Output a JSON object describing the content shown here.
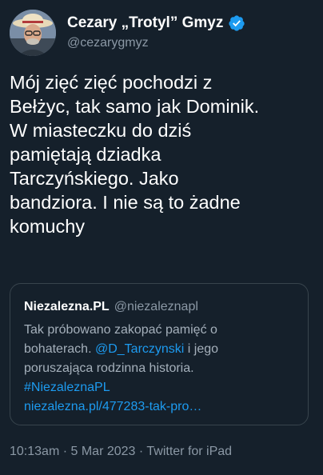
{
  "author": {
    "display_name": "Cezary „Trotyl” Gmyz",
    "handle": "@cezarygmyz",
    "verified": true
  },
  "tweet": {
    "text": "Mój zięć zięć pochodzi z\nBełżyc, tak samo jak Dominik.\nW miasteczku do dziś\npamiętają dziadka\nTarczyńskiego. Jako\nbandziora. I nie są to żadne\nkomuchy"
  },
  "quoted_tweet": {
    "author_name": "Niezalezna.PL",
    "author_handle": "@niezaleznapl",
    "line1": "Tak próbowano zakopać pamięć o",
    "line2_before": "bohaterach.",
    "line2_mention": "@D_Tarczynski",
    "line2_after": "i jego",
    "line3": "poruszająca rodzinna historia.",
    "hashtag": "#NiezaleznaPL",
    "url": "niezalezna.pl/477283-tak-pro…"
  },
  "footer": {
    "time": "10:13am",
    "separator1": "·",
    "date": "5 Mar 2023",
    "separator2": "·",
    "source": "Twitter for iPad"
  },
  "colors": {
    "background": "#15202b",
    "primary_text": "#ffffff",
    "secondary_text": "#8b98a5",
    "link": "#1d9bf0",
    "border": "#38444d"
  },
  "icons": {
    "verified": "verified-badge-icon"
  }
}
